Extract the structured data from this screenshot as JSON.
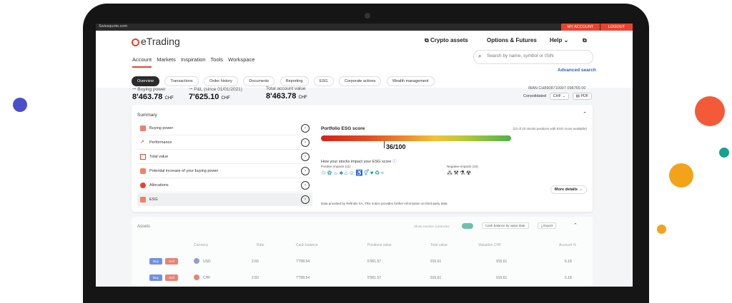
{
  "top_bar": {
    "site": "Swissquote.com",
    "my_account": "MY ACCOUNT",
    "logout": "LOGOUT"
  },
  "header": {
    "logo": "eTrading",
    "crypto": "Crypto assets",
    "options": "Options & Futures",
    "help": "Help"
  },
  "tabs": [
    "Account",
    "Markets",
    "Inspiration",
    "Tools",
    "Workspace"
  ],
  "search": {
    "placeholder": "Search by name, symbol or ISIN",
    "advanced": "Advanced search"
  },
  "pills": [
    "Overview",
    "Transactions",
    "Order history",
    "Documents",
    "Reporting",
    "ESG",
    "Corporate actions",
    "Wealth management"
  ],
  "stats": [
    {
      "label": "Buying power",
      "value": "8'463.78",
      "currency": "CHF"
    },
    {
      "label": "P&L (since 01/01/2021)",
      "value": "7'625.10",
      "currency": "CHF"
    },
    {
      "label": "Total account value",
      "value": "8'463.78",
      "currency": "CHF"
    }
  ],
  "account": {
    "iban": "IBAN CH8908710007 098765 00",
    "consolidated": "Consolidated",
    "currency": "CHF",
    "pdf": "PDF"
  },
  "summary": {
    "title": "Summary",
    "items": [
      "Buying power",
      "Performance",
      "Total value",
      "Potential increase of your buying power",
      "Allocations",
      "ESG"
    ]
  },
  "esg": {
    "title": "Portfolio ESG score",
    "note": "(23 of 23 stocks positions with ESG score available)",
    "score": "36/100",
    "score_value": 36,
    "question": "How your stocks impact your ESG score",
    "positive": "Positive impacts (11)",
    "negative": "Negative impacts (10)",
    "more": "More details",
    "provider": "Data provided by Refinitiv SA. This notice provides further information on third-party data."
  },
  "assets": {
    "title": "Assets",
    "show_inactive": "Show inactive currencies",
    "cash_btn": "Cash balance by value date",
    "export": "Export",
    "columns": [
      "Currency",
      "Rate",
      "Cash balance",
      "Positions value",
      "Total value",
      "Valuation CHF",
      "Account %"
    ],
    "rows": [
      {
        "buy": "Buy",
        "sell": "Sell",
        "currency": "USD",
        "rate": "2.60",
        "cash": "7'708.54",
        "positions": "5'961.57",
        "total": "915.61",
        "valuation": "915.61",
        "pct": "6.18"
      },
      {
        "buy": "Buy",
        "sell": "Sell",
        "currency": "CHF",
        "rate": "2.60",
        "cash": "7'708.54",
        "positions": "5'961.57",
        "total": "915.61",
        "valuation": "915.61",
        "pct": "6.18"
      }
    ]
  },
  "colors": {
    "accent": "#e8432f",
    "link": "#2a5bd7",
    "dot_blue": "#4b4fc9",
    "dot_red": "#f45a38",
    "dot_teal": "#14a38e",
    "dot_orange": "#f2a31a"
  }
}
